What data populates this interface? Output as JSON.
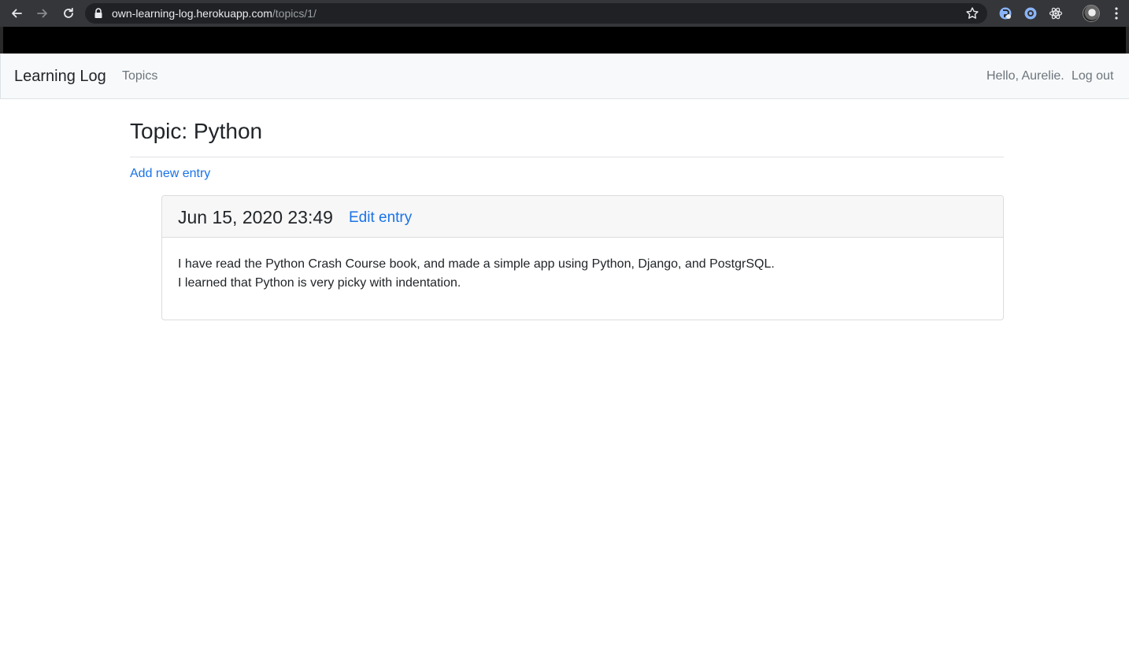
{
  "browser": {
    "url_host": "own-learning-log.herokuapp.com",
    "url_path": "/topics/1/",
    "icons": {
      "back": "back-arrow-icon",
      "forward": "forward-arrow-icon",
      "reload": "reload-icon",
      "lock": "lock-icon",
      "bookmark": "star-icon",
      "menu": "kebab-menu-icon"
    },
    "colors": {
      "toolbar_bg": "#35363a",
      "omnibox_bg": "#202124",
      "host_text": "#e8eaed",
      "path_text": "#9aa0a6"
    }
  },
  "navbar": {
    "brand": "Learning Log",
    "topics_link": "Topics",
    "greeting": "Hello, Aurelie.",
    "logout_link": "Log out"
  },
  "main": {
    "title": "Topic: Python",
    "add_entry_link": "Add new entry",
    "entries": [
      {
        "date": "Jun 15, 2020 23:49",
        "edit_link": "Edit entry",
        "lines": [
          "I have read the Python Crash Course book, and made a simple app using Python, Django, and PostgrSQL.",
          "I learned that Python is very picky with indentation."
        ]
      }
    ]
  },
  "colors": {
    "link": "#1a73e8",
    "navbar_bg": "#f8f9fa",
    "muted_text": "#6c757d",
    "body_text": "#212529",
    "card_header_bg": "#f7f7f7"
  }
}
